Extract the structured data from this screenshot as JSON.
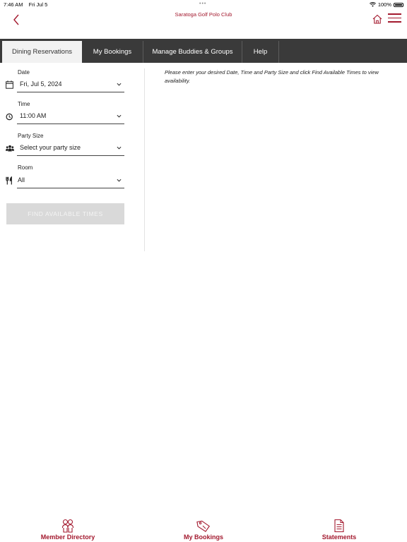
{
  "status_bar": {
    "time": "7:46 AM",
    "date": "Fri Jul 5",
    "battery": "100%"
  },
  "header": {
    "title": "Saratoga Golf Polo Club"
  },
  "tabs": [
    {
      "label": "Dining Reservations",
      "active": true
    },
    {
      "label": "My Bookings",
      "active": false
    },
    {
      "label": "Manage Buddies & Groups",
      "active": false
    },
    {
      "label": "Help",
      "active": false
    }
  ],
  "form": {
    "date": {
      "label": "Date",
      "value": "Fri, Jul 5, 2024",
      "icon": "calendar-icon"
    },
    "time": {
      "label": "Time",
      "value": "11:00 AM",
      "icon": "clock-icon"
    },
    "party_size": {
      "label": "Party Size",
      "value": "Select your party size",
      "icon": "group-icon"
    },
    "room": {
      "label": "Room",
      "value": "All",
      "icon": "fork-knife-icon"
    },
    "find_button": "FIND AVAILABLE TIMES"
  },
  "instructions": "Please enter your desired Date, Time and Party Size and click Find Available Times to view availability.",
  "bottom_nav": [
    {
      "label": "Member Directory",
      "icon": "people-icon"
    },
    {
      "label": "My Bookings",
      "icon": "tag-icon"
    },
    {
      "label": "Statements",
      "icon": "document-icon"
    }
  ],
  "colors": {
    "brand": "#a3192e",
    "tabbar": "#3a3a3a",
    "disabled_button": "#d9d9d9"
  }
}
